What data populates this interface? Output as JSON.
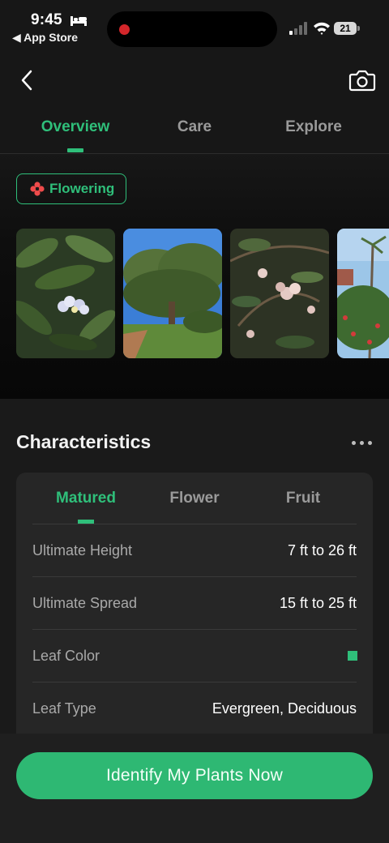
{
  "status_bar": {
    "time": "9:45",
    "back_app": "◀ App Store",
    "battery": "21"
  },
  "header": {
    "tabs": [
      {
        "label": "Overview",
        "active": true
      },
      {
        "label": "Care",
        "active": false
      },
      {
        "label": "Explore",
        "active": false
      }
    ]
  },
  "chip": {
    "label": "Flowering",
    "icon": "flower-icon"
  },
  "photos": [
    {
      "name": "plumeria-flower-closeup"
    },
    {
      "name": "plumeria-tree-blue-sky"
    },
    {
      "name": "plumeria-pink-blossoms"
    },
    {
      "name": "tropical-garden-palms"
    }
  ],
  "characteristics": {
    "title": "Characteristics",
    "tabs": [
      {
        "label": "Matured",
        "active": true
      },
      {
        "label": "Flower",
        "active": false
      },
      {
        "label": "Fruit",
        "active": false
      }
    ],
    "rows": [
      {
        "label": "Ultimate Height",
        "value": "7 ft to 26 ft"
      },
      {
        "label": "Ultimate Spread",
        "value": "15 ft to 25 ft"
      },
      {
        "label": "Leaf Color",
        "value": ""
      },
      {
        "label": "Leaf Type",
        "value": "Evergreen, Deciduous"
      }
    ],
    "leaf_color_swatch": "#2fbf7a"
  },
  "cta": {
    "label": "Identify My Plants Now"
  },
  "colors": {
    "accent": "#2fbf7a",
    "background": "#000000",
    "card": "#262626"
  }
}
